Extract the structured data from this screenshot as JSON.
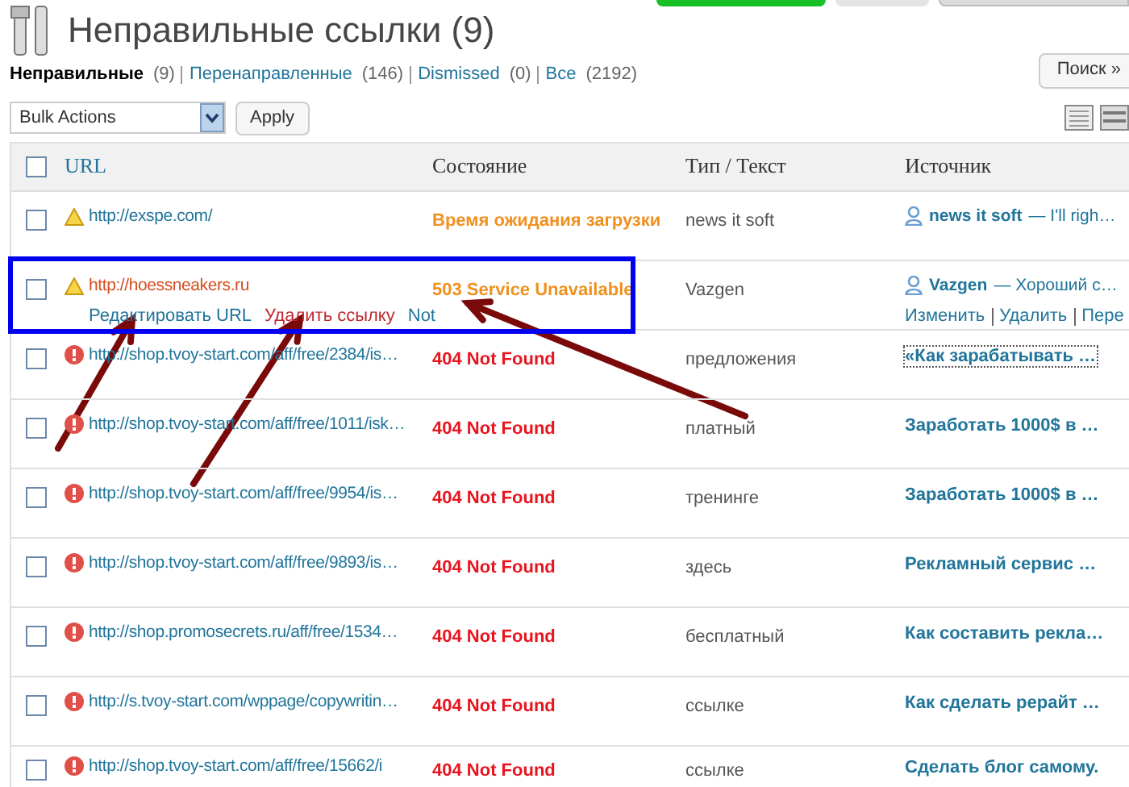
{
  "page": {
    "title": "Неправильные ссылки (9)"
  },
  "search_button": "Поиск »",
  "filters": [
    {
      "label": "Неправильные",
      "count": "(9)",
      "selected": true
    },
    {
      "label": "Перенаправленные",
      "count": "(146)",
      "selected": false
    },
    {
      "label": "Dismissed",
      "count": "(0)",
      "selected": false
    },
    {
      "label": "Все",
      "count": "(2192)",
      "selected": false
    }
  ],
  "bulk_actions": {
    "value": "Bulk Actions",
    "apply": "Apply"
  },
  "table": {
    "select_all": {
      "checked": false
    },
    "columns": [
      "URL",
      "Состояние",
      "Тип / Текст",
      "Источник"
    ],
    "rows": [
      {
        "kind": "warning",
        "url": "http://exspe.com/",
        "status": "Время ожидания загрузки",
        "text": "news it soft",
        "source": {
          "kind": "comment",
          "author": "news it soft",
          "excerpt": "— I'll righ…"
        },
        "checked": false,
        "highlighted": false
      },
      {
        "kind": "warning",
        "url": "http://hoessneakers.ru",
        "url_actions": [
          "Редактировать URL",
          "Удалить ссылку",
          "Not"
        ],
        "status": "503 Service Unavailable",
        "text": "Vazgen",
        "source": {
          "kind": "comment",
          "author": "Vazgen",
          "excerpt": "— Хороший с…",
          "actions": [
            "Изменить",
            "Удалить",
            "Пере"
          ]
        },
        "checked": false,
        "highlighted": true
      },
      {
        "kind": "error",
        "url": "http://shop.tvoy-start.com/aff/free/2384/is…",
        "status": "404 Not Found",
        "text": "предложения",
        "source": {
          "kind": "post",
          "title": "«Как зарабатывать …"
        },
        "checked": false,
        "highlighted": false
      },
      {
        "kind": "error",
        "url": "http://shop.tvoy-start.com/aff/free/1011/isk…",
        "status": "404 Not Found",
        "text": "платный",
        "source": {
          "kind": "post",
          "title": "Заработать 1000$ в …"
        },
        "checked": false,
        "highlighted": false
      },
      {
        "kind": "error",
        "url": "http://shop.tvoy-start.com/aff/free/9954/is…",
        "status": "404 Not Found",
        "text": "тренинге",
        "source": {
          "kind": "post",
          "title": "Заработать 1000$ в …"
        },
        "checked": false,
        "highlighted": false
      },
      {
        "kind": "error",
        "url": "http://shop.tvoy-start.com/aff/free/9893/is…",
        "status": "404 Not Found",
        "text": "здесь",
        "source": {
          "kind": "post",
          "title": "Рекламный сервис …"
        },
        "checked": false,
        "highlighted": false
      },
      {
        "kind": "error",
        "url": "http://shop.promosecrets.ru/aff/free/1534…",
        "status": "404 Not Found",
        "text": "бесплатный",
        "source": {
          "kind": "post",
          "title": "Как составить рекла…"
        },
        "checked": false,
        "highlighted": false
      },
      {
        "kind": "error",
        "url": "http://s.tvoy-start.com/wppage/copywritin…",
        "status": "404 Not Found",
        "text": "ссылке",
        "source": {
          "kind": "post",
          "title": "Как сделать рерайт …"
        },
        "checked": false,
        "highlighted": false
      },
      {
        "kind": "error",
        "url": "http://shop.tvoy-start.com/aff/free/15662/i",
        "status": "404 Not Found",
        "text": "ссылке",
        "source": {
          "kind": "post",
          "title": "Сделать блог самому."
        },
        "checked": false,
        "highlighted": false
      }
    ]
  }
}
